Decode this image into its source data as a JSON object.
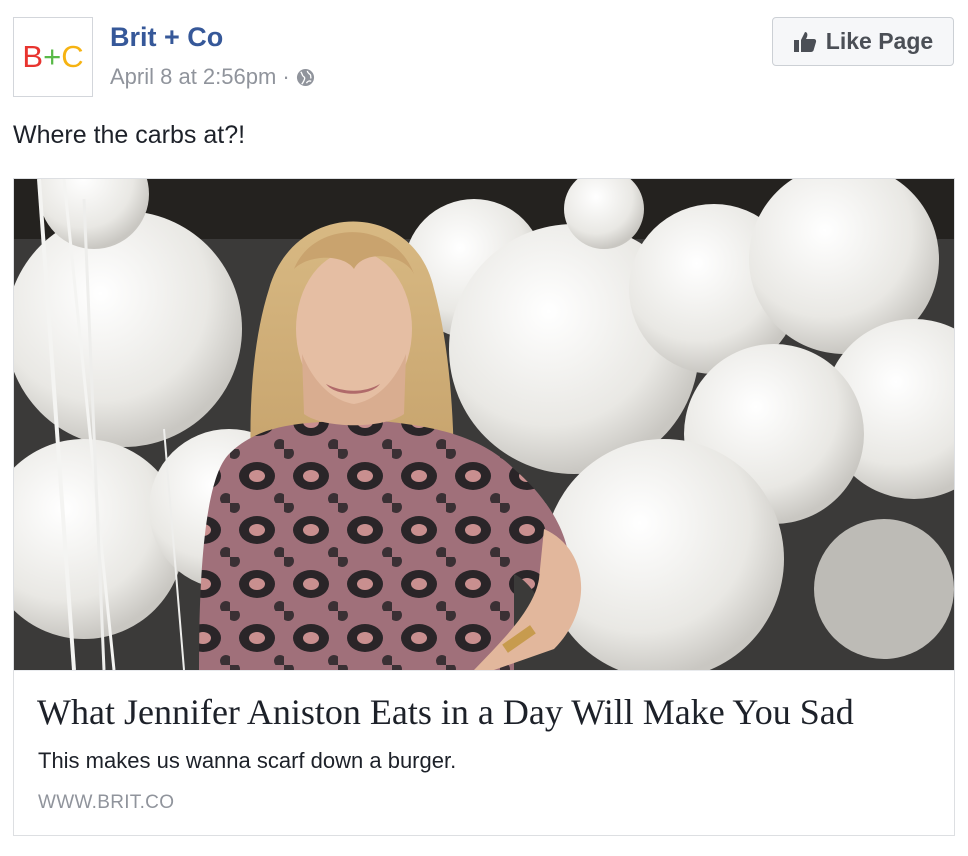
{
  "post": {
    "avatar": {
      "b": "B",
      "plus": "+",
      "c": "C"
    },
    "page_name": "Brit + Co",
    "timestamp": "April 8 at 2:56pm",
    "separator": "·",
    "privacy_icon": "globe-icon",
    "like_button": {
      "icon": "thumbs-up-icon",
      "label": "Like Page"
    },
    "message": "Where the carbs at?!"
  },
  "link_card": {
    "image_alt": "Woman with long blonde hair in a patterned dress standing in front of white balloons",
    "title": "What Jennifer Aniston Eats in a Day Will Make You Sad",
    "description": "This makes us wanna scarf down a burger.",
    "domain": "WWW.BRIT.CO"
  },
  "colors": {
    "link_blue": "#365899",
    "meta_gray": "#90949c",
    "brand_red": "#e8342f",
    "brand_green": "#58b947",
    "brand_yellow": "#f6b312"
  }
}
